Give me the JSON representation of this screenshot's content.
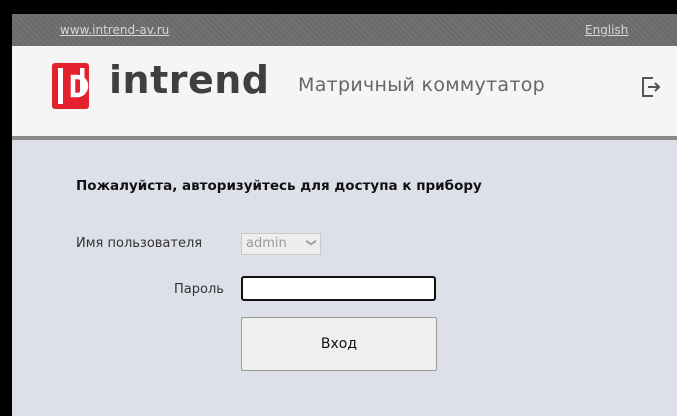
{
  "topbar": {
    "site_link": "www.intrend-av.ru",
    "language_link": "English"
  },
  "header": {
    "brand": "intrend",
    "subtitle": "Матричный коммутатор",
    "logo_icon": "intrend-logo-icon",
    "logout_icon": "logout-icon",
    "brand_color": "#e4222e"
  },
  "login": {
    "heading": "Пожалуйста, авторизуйтесь для доступа к прибору",
    "username_label": "Имя пользователя",
    "username_value": "admin",
    "password_label": "Пароль",
    "password_value": "",
    "submit_label": "Вход"
  }
}
